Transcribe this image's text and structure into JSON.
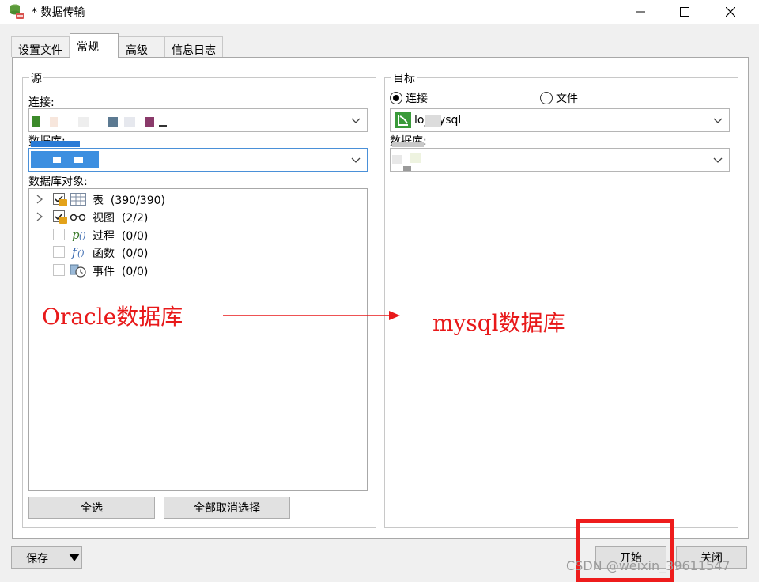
{
  "window": {
    "title": "* 数据传输",
    "controls": [
      "minimize",
      "maximize",
      "close"
    ]
  },
  "tabs": [
    {
      "label": "设置文件",
      "active": false
    },
    {
      "label": "常规",
      "active": true
    },
    {
      "label": "高级",
      "active": false
    },
    {
      "label": "信息日志",
      "active": false
    }
  ],
  "source": {
    "group_title": "源",
    "connection_label": "连接:",
    "database_label": "数据库:",
    "objects_label": "数据库对象:",
    "objects": [
      {
        "label": "表",
        "count": "(390/390)",
        "icon": "table-icon",
        "expandable": true,
        "checked": true
      },
      {
        "label": "视图",
        "count": "(2/2)",
        "icon": "view-icon",
        "expandable": true,
        "checked": true
      },
      {
        "label": "过程",
        "count": "(0/0)",
        "icon": "procedure-icon",
        "expandable": false,
        "checked": false
      },
      {
        "label": "函数",
        "count": "(0/0)",
        "icon": "function-icon",
        "expandable": false,
        "checked": false
      },
      {
        "label": "事件",
        "count": "(0/0)",
        "icon": "event-icon",
        "expandable": false,
        "checked": false
      }
    ],
    "select_all": "全选",
    "deselect_all": "全部取消选择"
  },
  "target": {
    "group_title": "目标",
    "radio_connection": "连接",
    "radio_file": "文件",
    "connection_value": "lo_ _ysql",
    "database_label": "数据库:"
  },
  "annotations": {
    "left": "Oracle数据库",
    "right": "mysql数据库"
  },
  "footer": {
    "save": "保存",
    "start": "开始",
    "close": "关闭"
  },
  "watermark": "CSDN @weixin_39611547",
  "colors": {
    "annotation_red": "#e8191a",
    "highlight_box": "#ee1c1c",
    "focus_border": "#4a90d8",
    "lock_gold": "#e3a21a"
  }
}
